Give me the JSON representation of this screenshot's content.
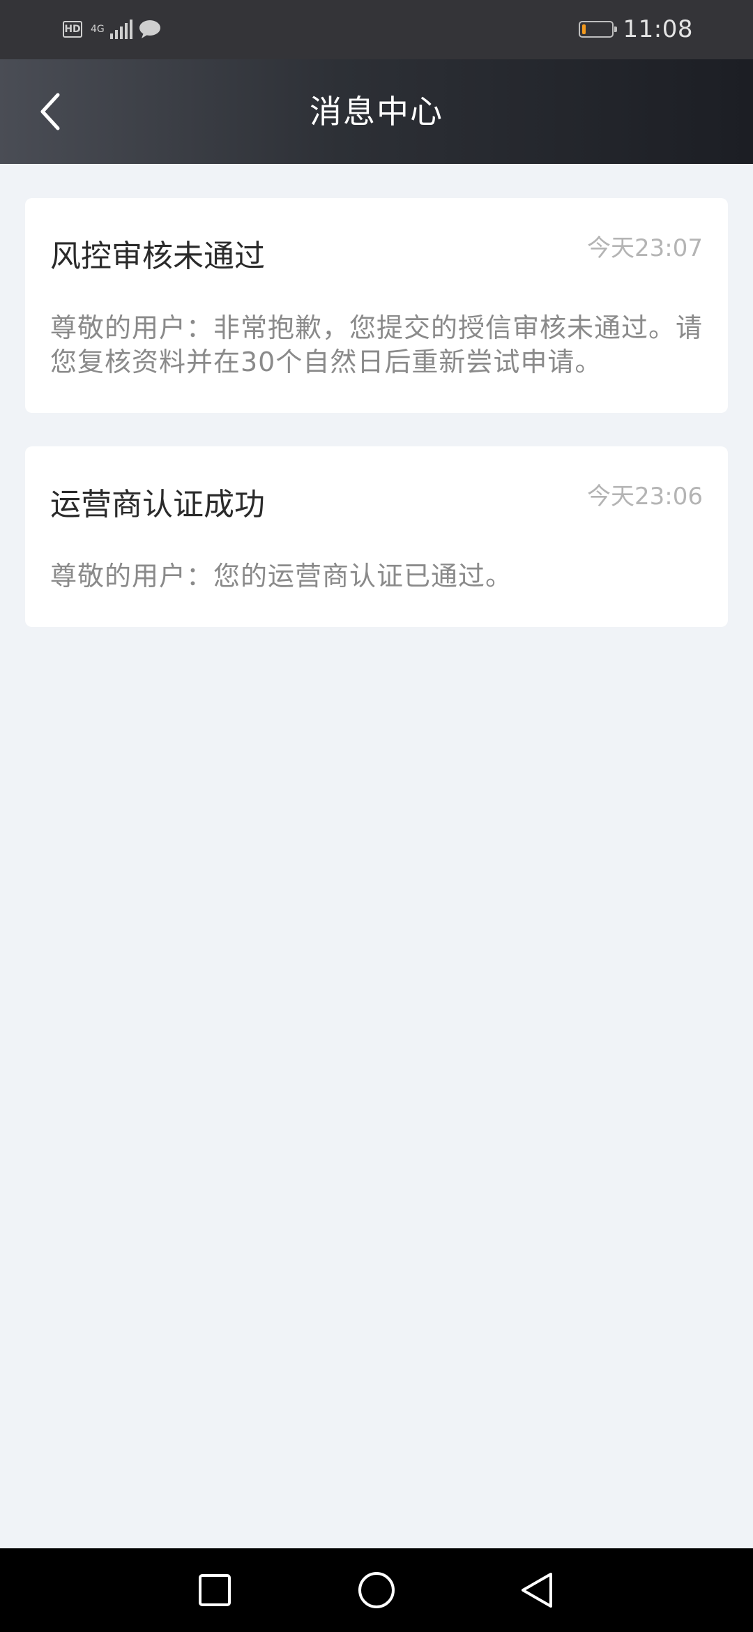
{
  "status_bar": {
    "hd_label": "HD",
    "network_type": "4G",
    "network_sub": "46",
    "time": "11:08",
    "battery_level": 0.12,
    "battery_color": "#f39a1e",
    "icons": [
      "hd-icon",
      "signal-icon",
      "chat-icon",
      "battery-icon"
    ]
  },
  "header": {
    "back_icon": "chevron-left-icon",
    "title": "消息中心"
  },
  "messages": [
    {
      "title": "风控审核未通过",
      "time": "今天23:07",
      "body": "尊敬的用户：非常抱歉，您提交的授信审核未通过。请您复核资料并在30个自然日后重新尝试申请。"
    },
    {
      "title": "运营商认证成功",
      "time": "今天23:06",
      "body": "尊敬的用户：您的运营商认证已通过。"
    }
  ],
  "nav_bar": {
    "buttons": [
      "recents-icon",
      "home-icon",
      "back-triangle-icon"
    ]
  },
  "colors": {
    "background": "#f0f3f7",
    "card": "#ffffff",
    "title_text": "#2a2a2a",
    "body_text": "#8a8a8a",
    "time_text": "#b4b4b4"
  }
}
